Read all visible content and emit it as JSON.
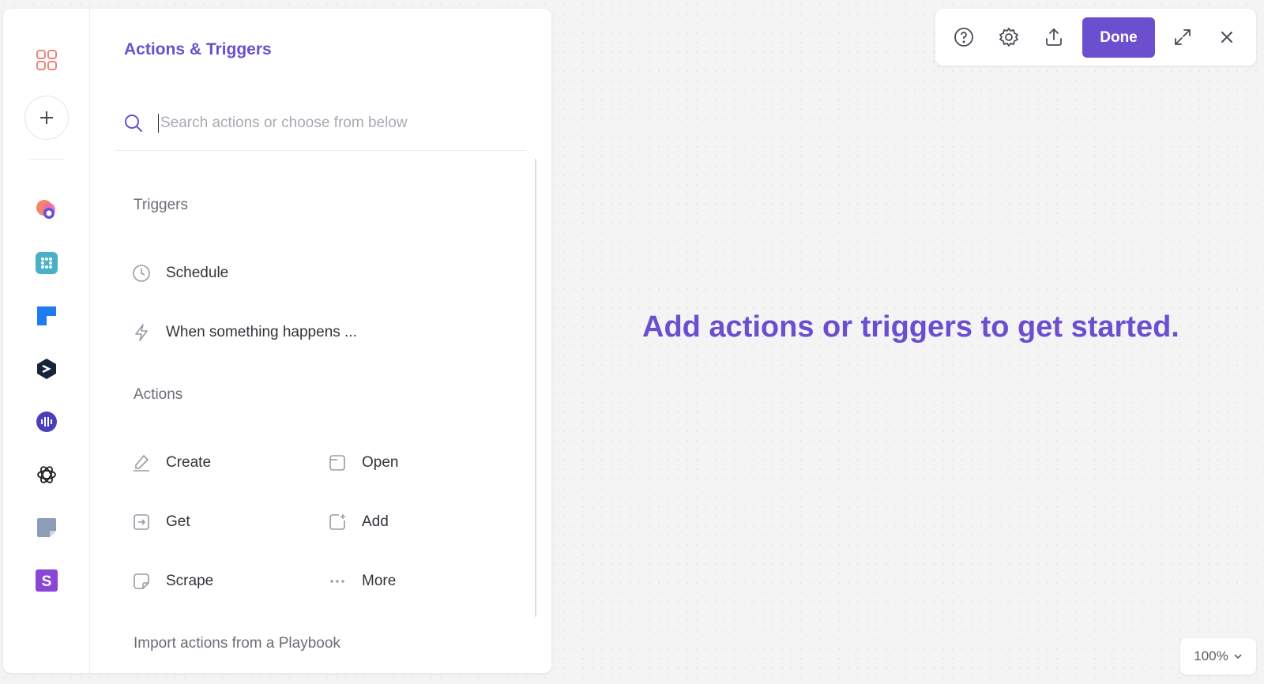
{
  "panel": {
    "title": "Actions & Triggers",
    "search_placeholder": "Search actions or choose from below",
    "search_value": ""
  },
  "rail": {
    "items": [
      {
        "name": "apps-grid-icon"
      },
      {
        "name": "add-button"
      },
      {
        "name": "app-gradient-icon"
      },
      {
        "name": "app-teal-grid-icon"
      },
      {
        "name": "app-blue-flag-icon"
      },
      {
        "name": "app-dark-hex-icon"
      },
      {
        "name": "app-voice-icon"
      },
      {
        "name": "openai-icon"
      },
      {
        "name": "app-note-icon"
      },
      {
        "name": "app-s-icon"
      }
    ]
  },
  "triggers": {
    "heading": "Triggers",
    "items": [
      {
        "label": "Schedule",
        "icon": "clock-icon"
      },
      {
        "label": "When something happens ...",
        "icon": "lightning-icon"
      }
    ]
  },
  "actions": {
    "heading": "Actions",
    "items": [
      {
        "label": "Create",
        "icon": "pen-icon"
      },
      {
        "label": "Open",
        "icon": "window-icon"
      },
      {
        "label": "Get",
        "icon": "import-icon"
      },
      {
        "label": "Add",
        "icon": "add-square-icon"
      },
      {
        "label": "Scrape",
        "icon": "note-icon"
      },
      {
        "label": "More",
        "icon": "ellipsis-icon"
      }
    ]
  },
  "import": {
    "heading": "Import actions from a Playbook"
  },
  "toolbar": {
    "done_label": "Done",
    "buttons": [
      "help-icon",
      "gear-icon",
      "share-icon",
      "expand-icon",
      "close-icon"
    ]
  },
  "canvas": {
    "message": "Add actions or triggers to get started."
  },
  "zoom": {
    "level": "100%"
  },
  "colors": {
    "accent": "#6b4fcf",
    "icon_gray": "#9a9aa6"
  }
}
